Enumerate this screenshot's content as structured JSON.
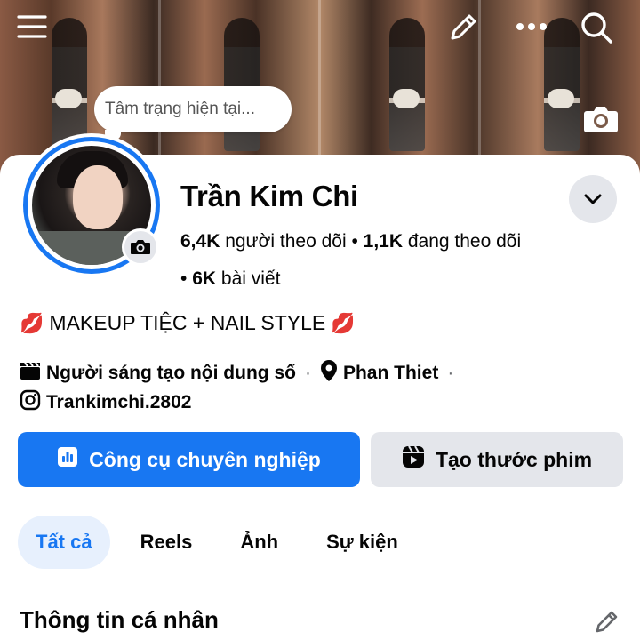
{
  "status": {
    "placeholder": "Tâm trạng hiện tại..."
  },
  "profile": {
    "name": "Trần Kim Chi",
    "followers_count": "6,4K",
    "followers_label": "người theo dõi",
    "following_count": "1,1K",
    "following_label": "đang theo dõi",
    "posts_count": "6K",
    "posts_label": "bài viết",
    "bio": "MAKEUP TIỆC + NAIL STYLE",
    "bio_emoji": "💋",
    "category": "Người sáng tạo nội dung số",
    "location": "Phan Thiet",
    "instagram": "Trankimchi.2802"
  },
  "buttons": {
    "pro_tools": "Công cụ chuyên nghiệp",
    "create_reel": "Tạo thước phim"
  },
  "tabs": [
    {
      "label": "Tất cả",
      "active": true
    },
    {
      "label": "Reels",
      "active": false
    },
    {
      "label": "Ảnh",
      "active": false
    },
    {
      "label": "Sự kiện",
      "active": false
    }
  ],
  "section": {
    "title": "Thông tin cá nhân"
  },
  "colors": {
    "accent": "#1877f2",
    "secondary_button": "#e4e6eb",
    "active_tab_bg": "#e7f0fd"
  },
  "icons": [
    "menu-icon",
    "edit-icon",
    "more-icon",
    "search-icon",
    "camera-icon",
    "chevron-down-icon",
    "clapperboard-icon",
    "location-pin-icon",
    "instagram-icon",
    "bar-chart-icon",
    "reel-icon",
    "pencil-icon"
  ]
}
